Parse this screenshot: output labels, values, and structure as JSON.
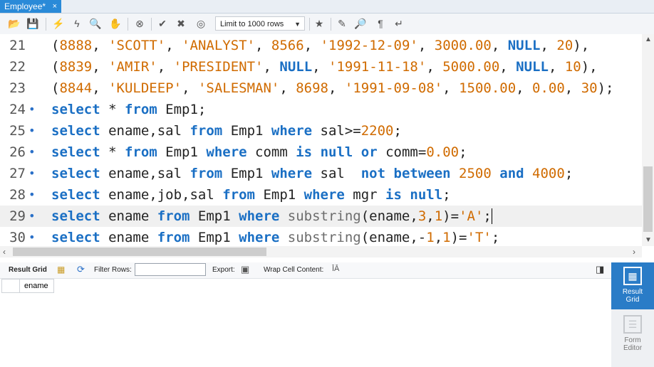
{
  "tab": {
    "title": "Employee*",
    "close": "×"
  },
  "toolbar": {
    "limit_label": "Limit to 1000 rows"
  },
  "editor": {
    "lines": [
      {
        "num": "21",
        "dot": "",
        "tokens": [
          [
            "(",
            "id"
          ],
          [
            "8888",
            "num"
          ],
          [
            ", ",
            "id"
          ],
          [
            "'SCOTT'",
            "str"
          ],
          [
            ", ",
            "id"
          ],
          [
            "'ANALYST'",
            "str"
          ],
          [
            ", ",
            "id"
          ],
          [
            "8566",
            "num"
          ],
          [
            ", ",
            "id"
          ],
          [
            "'1992-12-09'",
            "str"
          ],
          [
            ", ",
            "id"
          ],
          [
            "3000.00",
            "num"
          ],
          [
            ", ",
            "id"
          ],
          [
            "NULL",
            "kw"
          ],
          [
            ", ",
            "id"
          ],
          [
            "20",
            "num"
          ],
          [
            "),",
            "id"
          ]
        ]
      },
      {
        "num": "22",
        "dot": "",
        "tokens": [
          [
            "(",
            "id"
          ],
          [
            "8839",
            "num"
          ],
          [
            ", ",
            "id"
          ],
          [
            "'AMIR'",
            "str"
          ],
          [
            ", ",
            "id"
          ],
          [
            "'PRESIDENT'",
            "str"
          ],
          [
            ", ",
            "id"
          ],
          [
            "NULL",
            "kw"
          ],
          [
            ", ",
            "id"
          ],
          [
            "'1991-11-18'",
            "str"
          ],
          [
            ", ",
            "id"
          ],
          [
            "5000.00",
            "num"
          ],
          [
            ", ",
            "id"
          ],
          [
            "NULL",
            "kw"
          ],
          [
            ", ",
            "id"
          ],
          [
            "10",
            "num"
          ],
          [
            "),",
            "id"
          ]
        ]
      },
      {
        "num": "23",
        "dot": "",
        "tokens": [
          [
            "(",
            "id"
          ],
          [
            "8844",
            "num"
          ],
          [
            ", ",
            "id"
          ],
          [
            "'KULDEEP'",
            "str"
          ],
          [
            ", ",
            "id"
          ],
          [
            "'SALESMAN'",
            "str"
          ],
          [
            ", ",
            "id"
          ],
          [
            "8698",
            "num"
          ],
          [
            ", ",
            "id"
          ],
          [
            "'1991-09-08'",
            "str"
          ],
          [
            ", ",
            "id"
          ],
          [
            "1500.00",
            "num"
          ],
          [
            ", ",
            "id"
          ],
          [
            "0.00",
            "num"
          ],
          [
            ", ",
            "id"
          ],
          [
            "30",
            "num"
          ],
          [
            ");",
            "id"
          ]
        ]
      },
      {
        "num": "24",
        "dot": "•",
        "tokens": [
          [
            "select",
            "kw"
          ],
          [
            " * ",
            "id"
          ],
          [
            "from",
            "kw"
          ],
          [
            " Emp1;",
            "id"
          ]
        ]
      },
      {
        "num": "25",
        "dot": "•",
        "tokens": [
          [
            "select",
            "kw"
          ],
          [
            " ename,sal ",
            "id"
          ],
          [
            "from",
            "kw"
          ],
          [
            " Emp1 ",
            "id"
          ],
          [
            "where",
            "kw"
          ],
          [
            " sal>=",
            "id"
          ],
          [
            "2200",
            "num"
          ],
          [
            ";",
            "id"
          ]
        ]
      },
      {
        "num": "26",
        "dot": "•",
        "tokens": [
          [
            "select",
            "kw"
          ],
          [
            " * ",
            "id"
          ],
          [
            "from",
            "kw"
          ],
          [
            " Emp1 ",
            "id"
          ],
          [
            "where",
            "kw"
          ],
          [
            " comm ",
            "id"
          ],
          [
            "is",
            "kw"
          ],
          [
            " ",
            "id"
          ],
          [
            "null",
            "kw"
          ],
          [
            " ",
            "id"
          ],
          [
            "or",
            "kw"
          ],
          [
            " comm=",
            "id"
          ],
          [
            "0.00",
            "num"
          ],
          [
            ";",
            "id"
          ]
        ]
      },
      {
        "num": "27",
        "dot": "•",
        "tokens": [
          [
            "select",
            "kw"
          ],
          [
            " ename,sal ",
            "id"
          ],
          [
            "from",
            "kw"
          ],
          [
            " Emp1 ",
            "id"
          ],
          [
            "where",
            "kw"
          ],
          [
            " sal  ",
            "id"
          ],
          [
            "not",
            "kw"
          ],
          [
            " ",
            "id"
          ],
          [
            "between",
            "kw"
          ],
          [
            " ",
            "id"
          ],
          [
            "2500",
            "num"
          ],
          [
            " ",
            "id"
          ],
          [
            "and",
            "kw"
          ],
          [
            " ",
            "id"
          ],
          [
            "4000",
            "num"
          ],
          [
            ";",
            "id"
          ]
        ]
      },
      {
        "num": "28",
        "dot": "•",
        "tokens": [
          [
            "select",
            "kw"
          ],
          [
            " ename,job,sal ",
            "id"
          ],
          [
            "from",
            "kw"
          ],
          [
            " Emp1 ",
            "id"
          ],
          [
            "where",
            "kw"
          ],
          [
            " mgr ",
            "id"
          ],
          [
            "is",
            "kw"
          ],
          [
            " ",
            "id"
          ],
          [
            "null",
            "kw"
          ],
          [
            ";",
            "id"
          ]
        ]
      },
      {
        "num": "29",
        "dot": "•",
        "tokens": [
          [
            "select",
            "kw"
          ],
          [
            " ename ",
            "id"
          ],
          [
            "from",
            "kw"
          ],
          [
            " Emp1 ",
            "id"
          ],
          [
            "where",
            "kw"
          ],
          [
            " ",
            "id"
          ],
          [
            "substring",
            "fn"
          ],
          [
            "(ename,",
            "id"
          ],
          [
            "3",
            "num"
          ],
          [
            ",",
            "id"
          ],
          [
            "1",
            "num"
          ],
          [
            ")=",
            "id"
          ],
          [
            "'A'",
            "str"
          ],
          [
            ";",
            "id"
          ]
        ]
      },
      {
        "num": "30",
        "dot": "•",
        "tokens": [
          [
            "select",
            "kw"
          ],
          [
            " ename ",
            "id"
          ],
          [
            "from",
            "kw"
          ],
          [
            " Emp1 ",
            "id"
          ],
          [
            "where",
            "kw"
          ],
          [
            " ",
            "id"
          ],
          [
            "substring",
            "fn"
          ],
          [
            "(ename,-",
            "id"
          ],
          [
            "1",
            "num"
          ],
          [
            ",",
            "id"
          ],
          [
            "1",
            "num"
          ],
          [
            ")=",
            "id"
          ],
          [
            "'T'",
            "str"
          ],
          [
            ";",
            "id"
          ]
        ]
      }
    ]
  },
  "results": {
    "result_grid_label": "Result Grid",
    "filter_label": "Filter Rows:",
    "export_label": "Export:",
    "wrap_label": "Wrap Cell Content:",
    "column_header": "ename"
  },
  "side": {
    "result_grid": "Result Grid",
    "form_editor": "Form Editor"
  }
}
